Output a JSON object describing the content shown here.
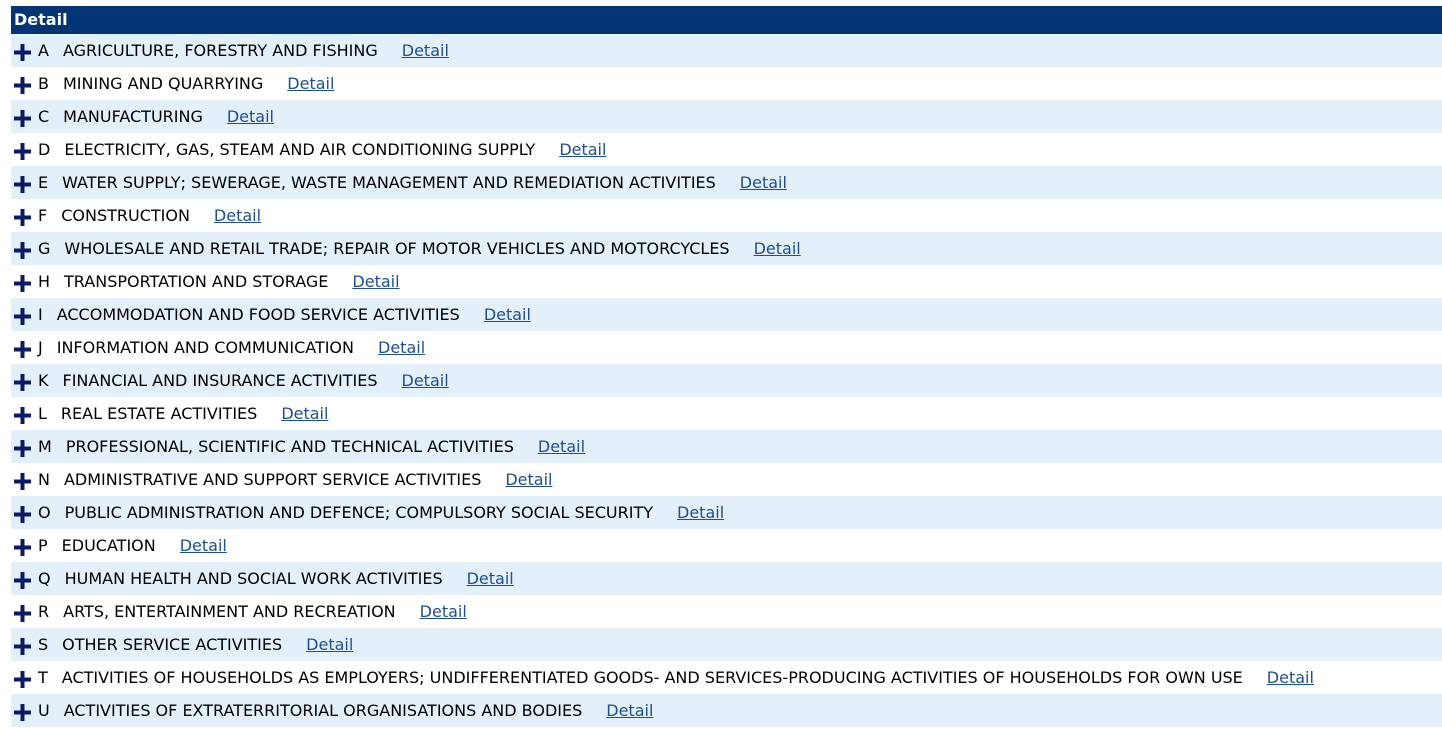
{
  "header": {
    "title": "Detail"
  },
  "link_label": "Detail",
  "colors": {
    "header_bg": "#033575",
    "row_alt": "#e4f0f9",
    "link": "#1c4f94",
    "plus_icon": "#0a1a66"
  },
  "rows": [
    {
      "code": "A",
      "title": "AGRICULTURE, FORESTRY AND FISHING"
    },
    {
      "code": "B",
      "title": "MINING AND QUARRYING"
    },
    {
      "code": "C",
      "title": "MANUFACTURING"
    },
    {
      "code": "D",
      "title": "ELECTRICITY, GAS, STEAM AND AIR CONDITIONING SUPPLY"
    },
    {
      "code": "E",
      "title": "WATER SUPPLY; SEWERAGE, WASTE MANAGEMENT AND REMEDIATION ACTIVITIES"
    },
    {
      "code": "F",
      "title": "CONSTRUCTION"
    },
    {
      "code": "G",
      "title": "WHOLESALE AND RETAIL TRADE; REPAIR OF MOTOR VEHICLES AND MOTORCYCLES"
    },
    {
      "code": "H",
      "title": "TRANSPORTATION AND STORAGE"
    },
    {
      "code": "I",
      "title": "ACCOMMODATION AND FOOD SERVICE ACTIVITIES"
    },
    {
      "code": "J",
      "title": "INFORMATION AND COMMUNICATION"
    },
    {
      "code": "K",
      "title": "FINANCIAL AND INSURANCE ACTIVITIES"
    },
    {
      "code": "L",
      "title": "REAL ESTATE ACTIVITIES"
    },
    {
      "code": "M",
      "title": "PROFESSIONAL, SCIENTIFIC AND TECHNICAL ACTIVITIES"
    },
    {
      "code": "N",
      "title": "ADMINISTRATIVE AND SUPPORT SERVICE ACTIVITIES"
    },
    {
      "code": "O",
      "title": "PUBLIC ADMINISTRATION AND DEFENCE; COMPULSORY SOCIAL SECURITY"
    },
    {
      "code": "P",
      "title": "EDUCATION"
    },
    {
      "code": "Q",
      "title": "HUMAN HEALTH AND SOCIAL WORK ACTIVITIES"
    },
    {
      "code": "R",
      "title": "ARTS, ENTERTAINMENT AND RECREATION"
    },
    {
      "code": "S",
      "title": "OTHER SERVICE ACTIVITIES"
    },
    {
      "code": "T",
      "title": "ACTIVITIES OF HOUSEHOLDS AS EMPLOYERS; UNDIFFERENTIATED GOODS- AND SERVICES-PRODUCING ACTIVITIES OF HOUSEHOLDS FOR OWN USE"
    },
    {
      "code": "U",
      "title": "ACTIVITIES OF EXTRATERRITORIAL ORGANISATIONS AND BODIES"
    }
  ]
}
